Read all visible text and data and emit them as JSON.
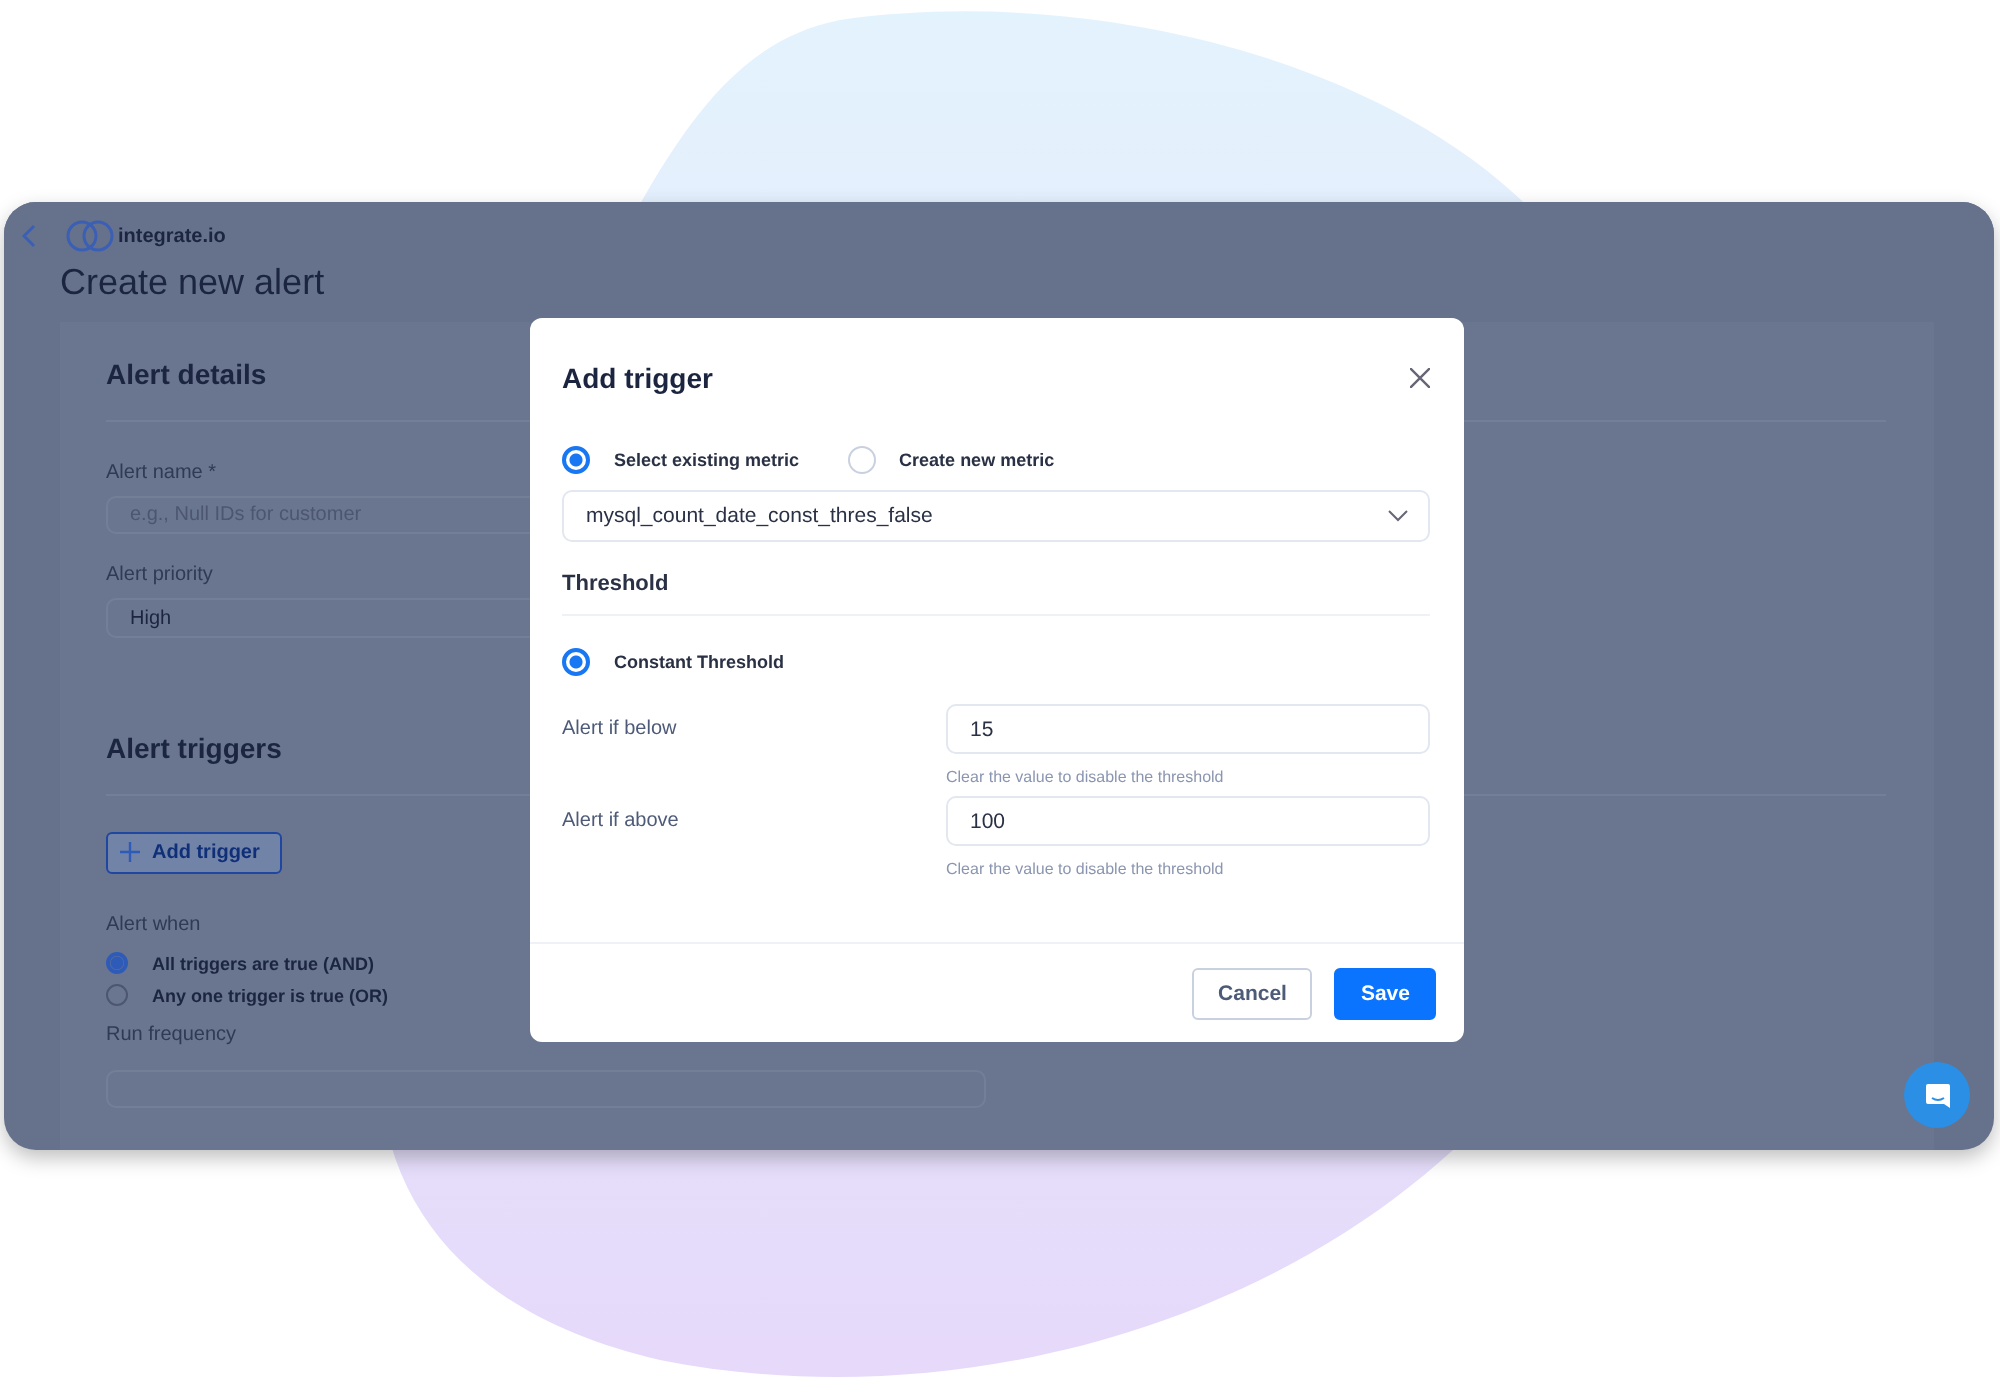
{
  "app": {
    "logo_text": "integrate.io",
    "page_title": "Create new alert"
  },
  "background_form": {
    "details_heading": "Alert details",
    "fields": [
      {
        "kind": "input",
        "label": "Alert name *",
        "placeholder": "e.g., Null IDs for customer"
      },
      {
        "kind": "select",
        "label": "Alert priority",
        "value": "High"
      }
    ],
    "triggers_heading": "Alert triggers",
    "add_trigger_button": "Add trigger",
    "alert_when_label": "Alert when",
    "alert_when_options": [
      {
        "label": "All triggers are true (AND)",
        "selected": true
      },
      {
        "label": "Any one trigger is true (OR)",
        "selected": false
      }
    ],
    "run_frequency_label": "Run frequency"
  },
  "dialog": {
    "title": "Add trigger",
    "metric_mode_options": [
      {
        "label": "Select existing metric",
        "selected": true
      },
      {
        "label": "Create new metric",
        "selected": false
      }
    ],
    "metric_select": {
      "value": "mysql_count_date_const_thres_false"
    },
    "threshold_heading": "Threshold",
    "threshold_type_options": [
      {
        "label": "Constant Threshold",
        "selected": true
      }
    ],
    "threshold_fields": [
      {
        "label": "Alert if below",
        "value": "15",
        "hint": "Clear the value to disable the threshold"
      },
      {
        "label": "Alert if above",
        "value": "100",
        "hint": "Clear the value to disable the threshold"
      }
    ],
    "buttons": [
      {
        "label": "Cancel",
        "kind": "secondary"
      },
      {
        "label": "Save",
        "kind": "primary"
      }
    ]
  }
}
